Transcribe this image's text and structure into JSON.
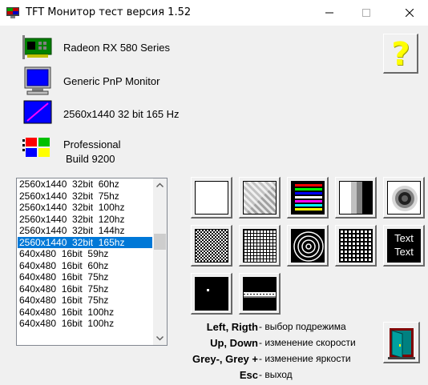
{
  "window": {
    "title": "TFT Монитор тест версия 1.52",
    "icon": "monitor-app-icon"
  },
  "info": {
    "gpu": "Radeon RX 580 Series",
    "monitor": "Generic PnP Monitor",
    "mode": "2560x1440 32 bit 165 Hz",
    "os_line1": "Professional",
    "os_line2": "Build 9200"
  },
  "help_button": {
    "label": "?"
  },
  "modes": [
    "2560x1440  32bit  60hz",
    "2560x1440  32bit  75hz",
    "2560x1440  32bit  100hz",
    "2560x1440  32bit  120hz",
    "2560x1440  32bit  144hz",
    "2560x1440  32bit  165hz",
    "640x480  16bit  59hz",
    "640x480  16bit  60hz",
    "640x480  16bit  75hz",
    "640x480  16bit  75hz",
    "640x480  16bit  75hz",
    "640x480  16bit  100hz",
    "640x480  16bit  100hz"
  ],
  "selected_mode": "2560x1440  32bit  165hz",
  "tests": {
    "text_button_line1": "Text",
    "text_button_line2": "Text"
  },
  "keys": [
    {
      "key": "Left, Rigth",
      "desc": "- выбор подрежима"
    },
    {
      "key": "Up, Down",
      "desc": "- изменение скорости"
    },
    {
      "key": "Grey-, Grey +",
      "desc": "- изменение яркости"
    },
    {
      "key": "Esc",
      "desc": "- выход"
    }
  ],
  "colors": {
    "selection": "#0078d7",
    "help": "#ffff00"
  }
}
